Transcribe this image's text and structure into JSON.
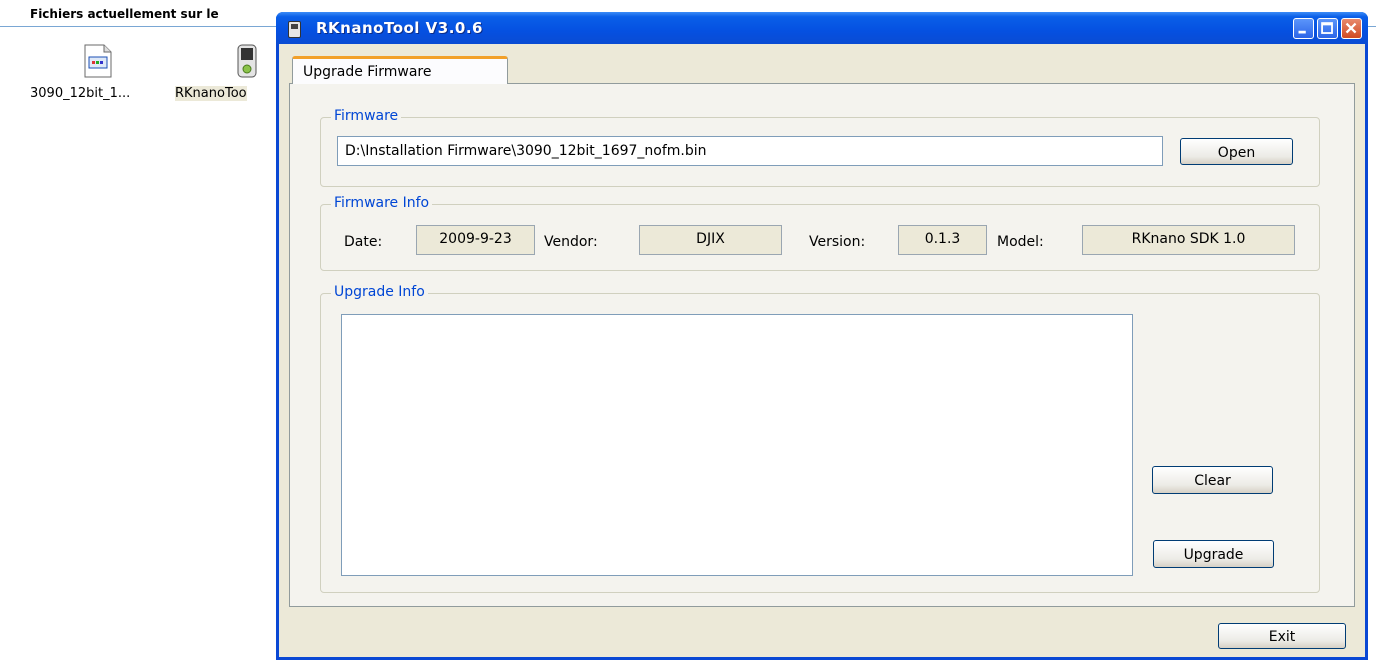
{
  "explorer": {
    "header_title": "Fichiers actuellement sur le",
    "files": [
      {
        "label": "3090_12bit_1...",
        "icon": "firmware-file-icon"
      },
      {
        "label": "RKnanoToo",
        "icon": "rknanotool-app-icon"
      }
    ]
  },
  "window": {
    "title": "RKnanoTool V3.0.6",
    "controls": [
      "minimize",
      "maximize",
      "close"
    ]
  },
  "tabs": [
    {
      "label": "Upgrade Firmware",
      "active": true
    }
  ],
  "firmware": {
    "legend": "Firmware",
    "path": "D:\\Installation Firmware\\3090_12bit_1697_nofm.bin",
    "open_label": "Open"
  },
  "firmware_info": {
    "legend": "Firmware Info",
    "date_label": "Date:",
    "date_value": "2009-9-23",
    "vendor_label": "Vendor:",
    "vendor_value": "DJIX",
    "version_label": "Version:",
    "version_value": "0.1.3",
    "model_label": "Model:",
    "model_value": "RKnano SDK 1.0"
  },
  "upgrade_info": {
    "legend": "Upgrade Info",
    "log": "",
    "clear_label": "Clear",
    "upgrade_label": "Upgrade"
  },
  "footer": {
    "exit_label": "Exit"
  },
  "colors": {
    "titlebar": "#0a5fe8",
    "client_bg": "#ece9d8",
    "legend_text": "#0046d5",
    "tab_accent": "#f2a028"
  }
}
